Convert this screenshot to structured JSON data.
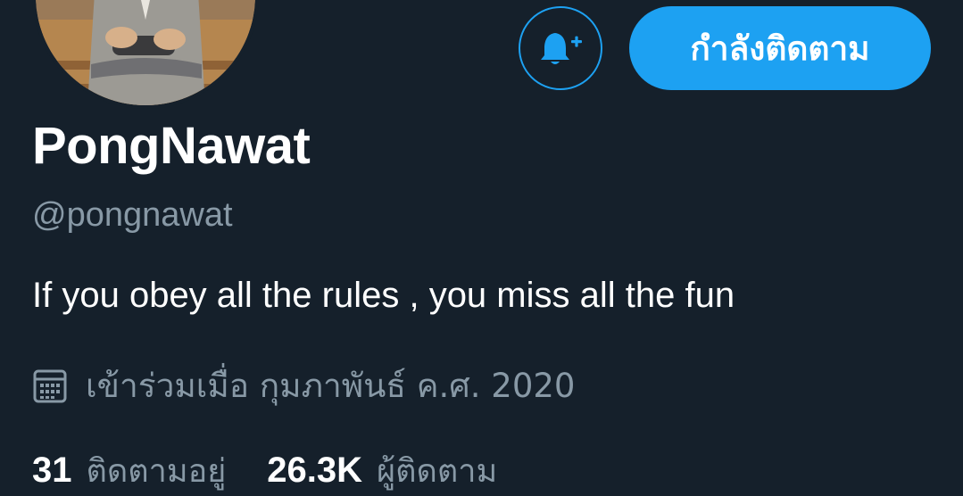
{
  "profile": {
    "display_name": "PongNawat",
    "handle": "@pongnawat",
    "bio": "If you obey all the rules , you miss all the fun",
    "joined": "เข้าร่วมเมื่อ กุมภาพันธ์ ค.ศ. 2020",
    "avatar_icon": "profile-photo"
  },
  "actions": {
    "notify_icon": "bell-plus-icon",
    "follow_label": "กำลังติดตาม"
  },
  "stats": {
    "following_count": "31",
    "following_label": "ติดตามอยู่",
    "followers_count": "26.3K",
    "followers_label": "ผู้ติดตาม"
  },
  "colors": {
    "background": "#15202b",
    "accent": "#1da1f2",
    "secondary_text": "#8899a6",
    "primary_text": "#ffffff"
  }
}
